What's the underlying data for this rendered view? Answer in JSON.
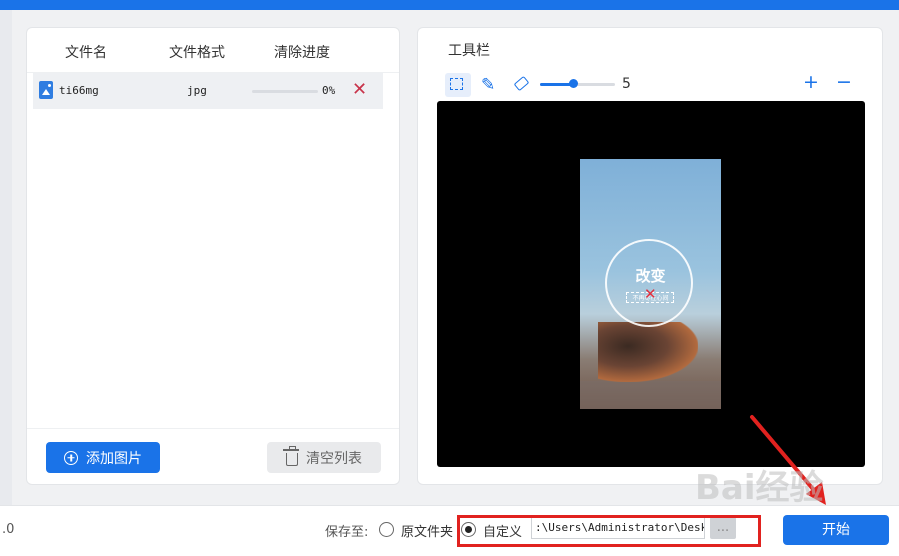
{
  "file_list": {
    "headers": [
      "文件名",
      "文件格式",
      "清除进度"
    ],
    "rows": [
      {
        "name": "ti66mg",
        "format": "jpg",
        "progress_text": "0%",
        "progress_fraction": 0
      }
    ],
    "add_label": "添加图片",
    "clear_label": "清空列表"
  },
  "toolbar": {
    "title": "工具栏",
    "brush_size": "5",
    "brush_fraction": 0.45,
    "zoom_in": "+",
    "zoom_out": "−",
    "tools": [
      "select-icon",
      "pen-icon",
      "eraser-icon"
    ]
  },
  "preview": {
    "big_text": "改变",
    "small_text": "不再尽在心间"
  },
  "bottom": {
    "version": ".0",
    "save_label": "保存至:",
    "option_original": "原文件夹",
    "option_custom": "自定义",
    "path": ":\\Users\\Administrator\\Desktop",
    "more_label": "...",
    "start_label": "开始"
  },
  "watermark": "Bai经验",
  "colors": {
    "accent": "#1a73e8",
    "highlight": "#e1221f",
    "remove": "#c8334a"
  }
}
